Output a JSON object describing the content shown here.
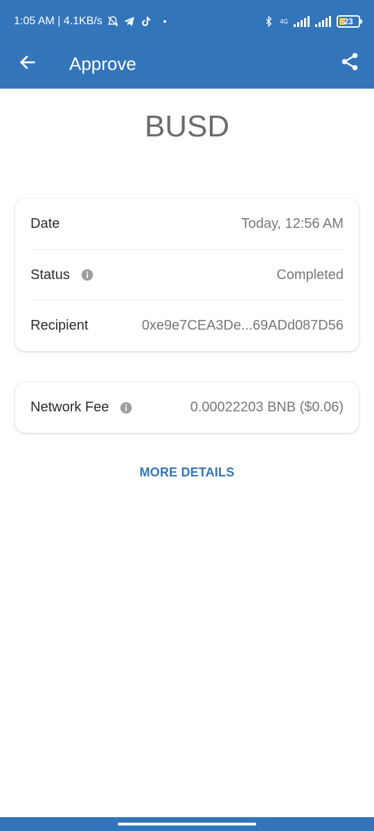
{
  "status_bar": {
    "time": "1:05 AM | 4.1KB/s",
    "network_label": "4G",
    "battery_level": "23",
    "icons": [
      "muted-bell-icon",
      "telegram-icon",
      "tiktok-icon",
      "bluetooth-icon",
      "signal-icon",
      "signal-icon",
      "battery-icon"
    ]
  },
  "header": {
    "title": "Approve",
    "back_icon": "arrow-left-icon",
    "share_icon": "share-icon"
  },
  "token": {
    "symbol": "BUSD"
  },
  "details": {
    "date_label": "Date",
    "date_value": "Today, 12:56 AM",
    "status_label": "Status",
    "status_value": "Completed",
    "recipient_label": "Recipient",
    "recipient_value": "0xe9e7CEA3De...69ADd087D56"
  },
  "fee": {
    "label": "Network Fee",
    "value": "0.00022203 BNB ($0.06)"
  },
  "actions": {
    "more_details": "MORE DETAILS"
  },
  "colors": {
    "primary": "#3375BB",
    "muted_text": "#777777",
    "token_text": "#6B6B6B"
  }
}
